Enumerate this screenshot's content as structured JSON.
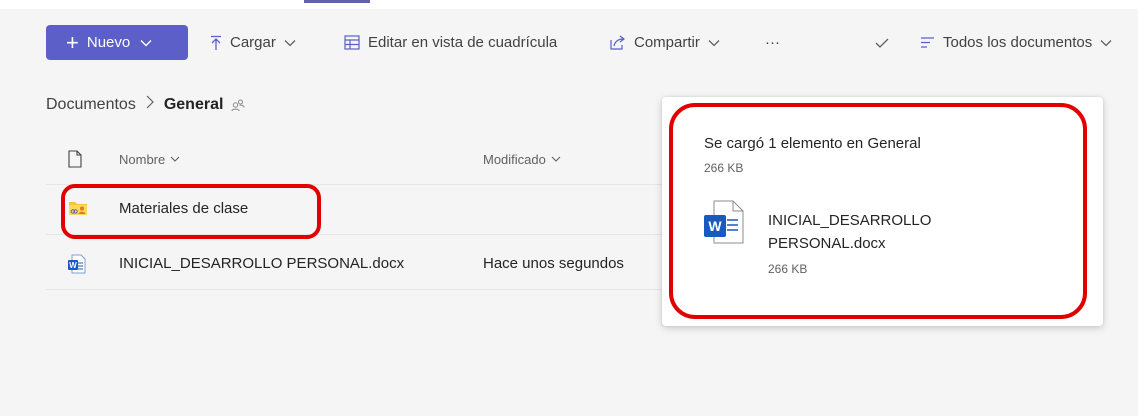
{
  "toolbar": {
    "new_label": "Nuevo",
    "upload_label": "Cargar",
    "grid_edit_label": "Editar en vista de cuadrícula",
    "share_label": "Compartir",
    "more_label": "···",
    "view_label": "Todos los documentos"
  },
  "breadcrumb": {
    "root": "Documentos",
    "separator": ">",
    "current": "General"
  },
  "list": {
    "columns": {
      "name": "Nombre",
      "modified": "Modificado"
    },
    "rows": [
      {
        "name": "Materiales de clase",
        "modified": "",
        "icon": "folder-icon"
      },
      {
        "name": "INICIAL_DESARROLLO PERSONAL.docx",
        "modified": "Hace unos segundos",
        "icon": "word-doc-icon"
      }
    ]
  },
  "toast": {
    "title": "Se cargó 1 elemento en General",
    "total_size": "266 KB",
    "file_name": "INICIAL_DESARROLLO PERSONAL.docx",
    "file_size": "266 KB"
  },
  "colors": {
    "brand": "#5b5fc7",
    "highlight": "#e00000",
    "word_blue": "#185abd",
    "folder_yellow": "#f5c33b"
  }
}
